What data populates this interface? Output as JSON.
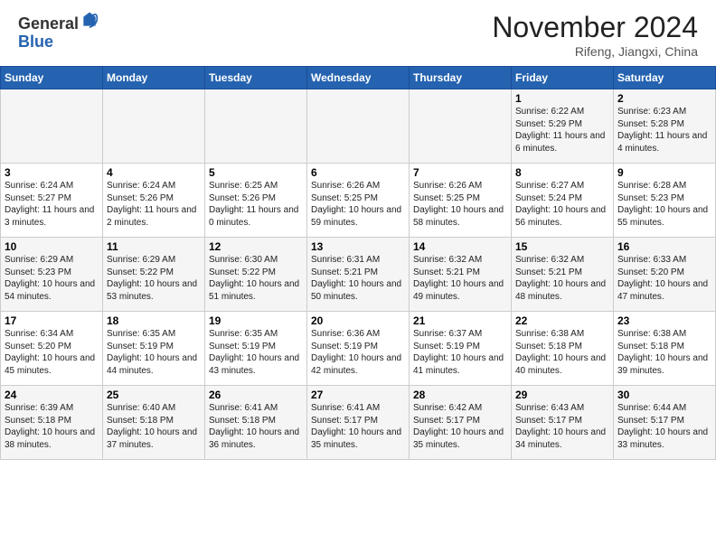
{
  "logo": {
    "line1": "General",
    "line2": "Blue"
  },
  "title": "November 2024",
  "subtitle": "Rifeng, Jiangxi, China",
  "weekdays": [
    "Sunday",
    "Monday",
    "Tuesday",
    "Wednesday",
    "Thursday",
    "Friday",
    "Saturday"
  ],
  "weeks": [
    [
      {
        "day": "",
        "detail": ""
      },
      {
        "day": "",
        "detail": ""
      },
      {
        "day": "",
        "detail": ""
      },
      {
        "day": "",
        "detail": ""
      },
      {
        "day": "",
        "detail": ""
      },
      {
        "day": "1",
        "detail": "Sunrise: 6:22 AM\nSunset: 5:29 PM\nDaylight: 11 hours and 6 minutes."
      },
      {
        "day": "2",
        "detail": "Sunrise: 6:23 AM\nSunset: 5:28 PM\nDaylight: 11 hours and 4 minutes."
      }
    ],
    [
      {
        "day": "3",
        "detail": "Sunrise: 6:24 AM\nSunset: 5:27 PM\nDaylight: 11 hours and 3 minutes."
      },
      {
        "day": "4",
        "detail": "Sunrise: 6:24 AM\nSunset: 5:26 PM\nDaylight: 11 hours and 2 minutes."
      },
      {
        "day": "5",
        "detail": "Sunrise: 6:25 AM\nSunset: 5:26 PM\nDaylight: 11 hours and 0 minutes."
      },
      {
        "day": "6",
        "detail": "Sunrise: 6:26 AM\nSunset: 5:25 PM\nDaylight: 10 hours and 59 minutes."
      },
      {
        "day": "7",
        "detail": "Sunrise: 6:26 AM\nSunset: 5:25 PM\nDaylight: 10 hours and 58 minutes."
      },
      {
        "day": "8",
        "detail": "Sunrise: 6:27 AM\nSunset: 5:24 PM\nDaylight: 10 hours and 56 minutes."
      },
      {
        "day": "9",
        "detail": "Sunrise: 6:28 AM\nSunset: 5:23 PM\nDaylight: 10 hours and 55 minutes."
      }
    ],
    [
      {
        "day": "10",
        "detail": "Sunrise: 6:29 AM\nSunset: 5:23 PM\nDaylight: 10 hours and 54 minutes."
      },
      {
        "day": "11",
        "detail": "Sunrise: 6:29 AM\nSunset: 5:22 PM\nDaylight: 10 hours and 53 minutes."
      },
      {
        "day": "12",
        "detail": "Sunrise: 6:30 AM\nSunset: 5:22 PM\nDaylight: 10 hours and 51 minutes."
      },
      {
        "day": "13",
        "detail": "Sunrise: 6:31 AM\nSunset: 5:21 PM\nDaylight: 10 hours and 50 minutes."
      },
      {
        "day": "14",
        "detail": "Sunrise: 6:32 AM\nSunset: 5:21 PM\nDaylight: 10 hours and 49 minutes."
      },
      {
        "day": "15",
        "detail": "Sunrise: 6:32 AM\nSunset: 5:21 PM\nDaylight: 10 hours and 48 minutes."
      },
      {
        "day": "16",
        "detail": "Sunrise: 6:33 AM\nSunset: 5:20 PM\nDaylight: 10 hours and 47 minutes."
      }
    ],
    [
      {
        "day": "17",
        "detail": "Sunrise: 6:34 AM\nSunset: 5:20 PM\nDaylight: 10 hours and 45 minutes."
      },
      {
        "day": "18",
        "detail": "Sunrise: 6:35 AM\nSunset: 5:19 PM\nDaylight: 10 hours and 44 minutes."
      },
      {
        "day": "19",
        "detail": "Sunrise: 6:35 AM\nSunset: 5:19 PM\nDaylight: 10 hours and 43 minutes."
      },
      {
        "day": "20",
        "detail": "Sunrise: 6:36 AM\nSunset: 5:19 PM\nDaylight: 10 hours and 42 minutes."
      },
      {
        "day": "21",
        "detail": "Sunrise: 6:37 AM\nSunset: 5:19 PM\nDaylight: 10 hours and 41 minutes."
      },
      {
        "day": "22",
        "detail": "Sunrise: 6:38 AM\nSunset: 5:18 PM\nDaylight: 10 hours and 40 minutes."
      },
      {
        "day": "23",
        "detail": "Sunrise: 6:38 AM\nSunset: 5:18 PM\nDaylight: 10 hours and 39 minutes."
      }
    ],
    [
      {
        "day": "24",
        "detail": "Sunrise: 6:39 AM\nSunset: 5:18 PM\nDaylight: 10 hours and 38 minutes."
      },
      {
        "day": "25",
        "detail": "Sunrise: 6:40 AM\nSunset: 5:18 PM\nDaylight: 10 hours and 37 minutes."
      },
      {
        "day": "26",
        "detail": "Sunrise: 6:41 AM\nSunset: 5:18 PM\nDaylight: 10 hours and 36 minutes."
      },
      {
        "day": "27",
        "detail": "Sunrise: 6:41 AM\nSunset: 5:17 PM\nDaylight: 10 hours and 35 minutes."
      },
      {
        "day": "28",
        "detail": "Sunrise: 6:42 AM\nSunset: 5:17 PM\nDaylight: 10 hours and 35 minutes."
      },
      {
        "day": "29",
        "detail": "Sunrise: 6:43 AM\nSunset: 5:17 PM\nDaylight: 10 hours and 34 minutes."
      },
      {
        "day": "30",
        "detail": "Sunrise: 6:44 AM\nSunset: 5:17 PM\nDaylight: 10 hours and 33 minutes."
      }
    ]
  ]
}
